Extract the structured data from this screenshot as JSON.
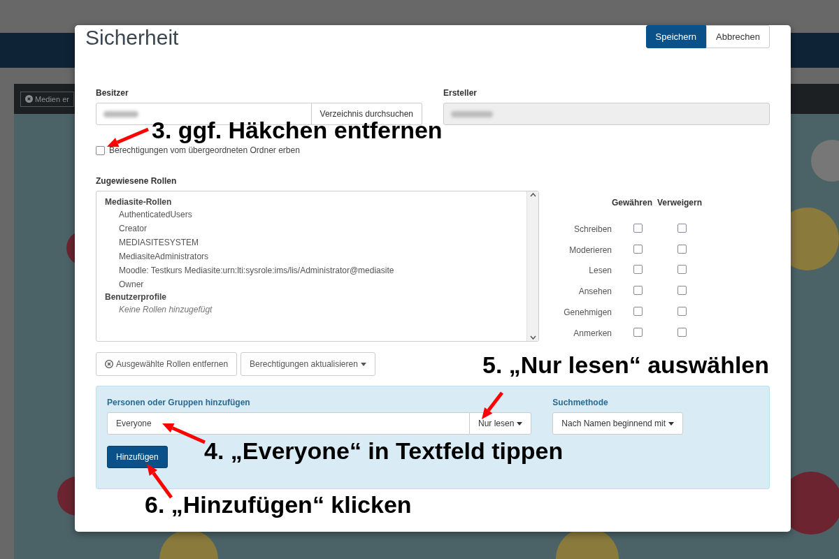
{
  "background": {
    "toolbar_button": "Medien er"
  },
  "dialog": {
    "title": "Sicherheit",
    "buttons": [
      {
        "label": "Speichern",
        "kind": "primary"
      },
      {
        "label": "Abbrechen",
        "kind": "default"
      }
    ],
    "owner": {
      "label": "Besitzer",
      "browse_button": "Verzeichnis durchsuchen"
    },
    "creator": {
      "label": "Ersteller"
    },
    "inherit": {
      "label": "Berechtigungen vom übergeordneten Ordner erben",
      "checked": false
    },
    "roles": {
      "label": "Zugewiesene Rollen",
      "groups": [
        {
          "name": "Mediasite-Rollen",
          "children": [
            {
              "name": "AuthenticatedUsers"
            },
            {
              "name": "Creator"
            },
            {
              "name": "MEDIASITESYSTEM"
            },
            {
              "name": "MediasiteAdministrators"
            },
            {
              "name": "Moodle: Testkurs Mediasite:urn:lti:sysrole:ims/lis/Administrator@mediasite"
            },
            {
              "name": "Owner"
            }
          ]
        },
        {
          "name": "Benutzerprofile",
          "empty_text": "Keine Rollen hinzugefügt"
        }
      ]
    },
    "permissions": {
      "columns": [
        "Gewähren",
        "Verweigern"
      ],
      "rows": [
        {
          "label": "Schreiben",
          "grant": false,
          "deny": false
        },
        {
          "label": "Moderieren",
          "grant": false,
          "deny": false
        },
        {
          "label": "Lesen",
          "grant": false,
          "deny": false
        },
        {
          "label": "Ansehen",
          "grant": false,
          "deny": false
        },
        {
          "label": "Genehmigen",
          "grant": false,
          "deny": false
        },
        {
          "label": "Anmerken",
          "grant": false,
          "deny": false
        }
      ]
    },
    "role_buttons": [
      {
        "label": "Ausgewählte Rollen entfernen",
        "kind": "remove"
      },
      {
        "label": "Berechtigungen aktualisieren",
        "kind": "dropdown"
      }
    ],
    "add_panel": {
      "label": "Personen oder Gruppen hinzufügen",
      "value": "Everyone",
      "access": "Nur lesen",
      "search_label": "Suchmethode",
      "search_method": "Nach Namen beginnend mit",
      "add_button": "Hinzufügen"
    }
  },
  "annotations": [
    {
      "text": "3. ggf. Häkchen entfernen"
    },
    {
      "text": "5. „Nur lesen“ auswählen"
    },
    {
      "text": "4. „Everyone“ in Textfeld tippen"
    },
    {
      "text": "6. „Hinzufügen“ klicken"
    }
  ]
}
